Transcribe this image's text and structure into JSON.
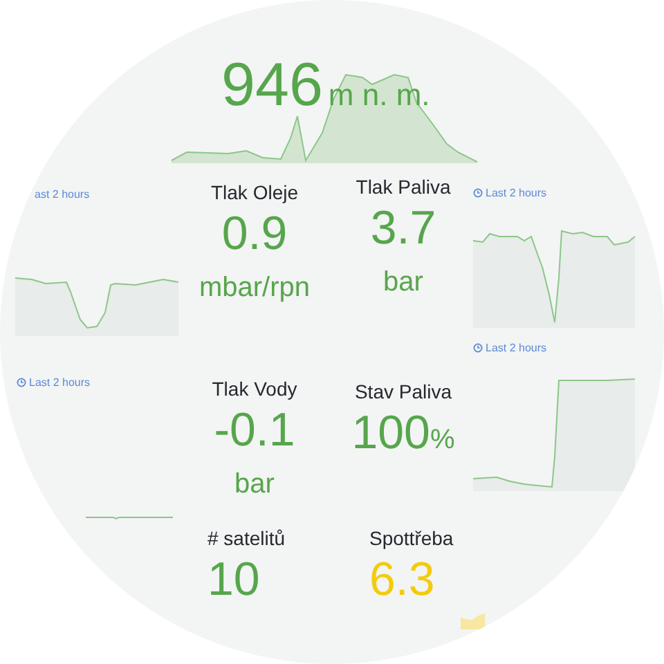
{
  "altitude": {
    "value": "946",
    "unit": "m n. m.",
    "color": "#56a64b"
  },
  "left_panels": [
    {
      "time_label": "ast 2 hours",
      "clock_icon": false
    },
    {
      "time_label": "Last 2 hours",
      "clock_icon": true
    }
  ],
  "stats": [
    {
      "title": "Tlak Oleje",
      "value": "0.9",
      "unit": "mbar/rpn",
      "kind": "below",
      "color": "#56a64b"
    },
    {
      "title": "Tlak Paliva",
      "value": "3.7",
      "unit": "bar",
      "kind": "below",
      "color": "#56a64b"
    },
    {
      "title": "Tlak Vody",
      "value": "-0.1",
      "unit": "bar",
      "kind": "below",
      "color": "#56a64b"
    },
    {
      "title": "Stav Paliva",
      "value": "100",
      "unit": "%",
      "kind": "inline",
      "color": "#56a64b"
    },
    {
      "title": "# satelitů",
      "value": "10",
      "kind": "none",
      "color": "#56a64b"
    },
    {
      "title": "Spottřeba",
      "value": "6.3",
      "kind": "none",
      "color": "#f2cc0c"
    }
  ],
  "right_panels": [
    {
      "time_label": "Last 2 hours",
      "clock_icon": true
    },
    {
      "time_label": "Last 2 hours",
      "clock_icon": true
    }
  ]
}
